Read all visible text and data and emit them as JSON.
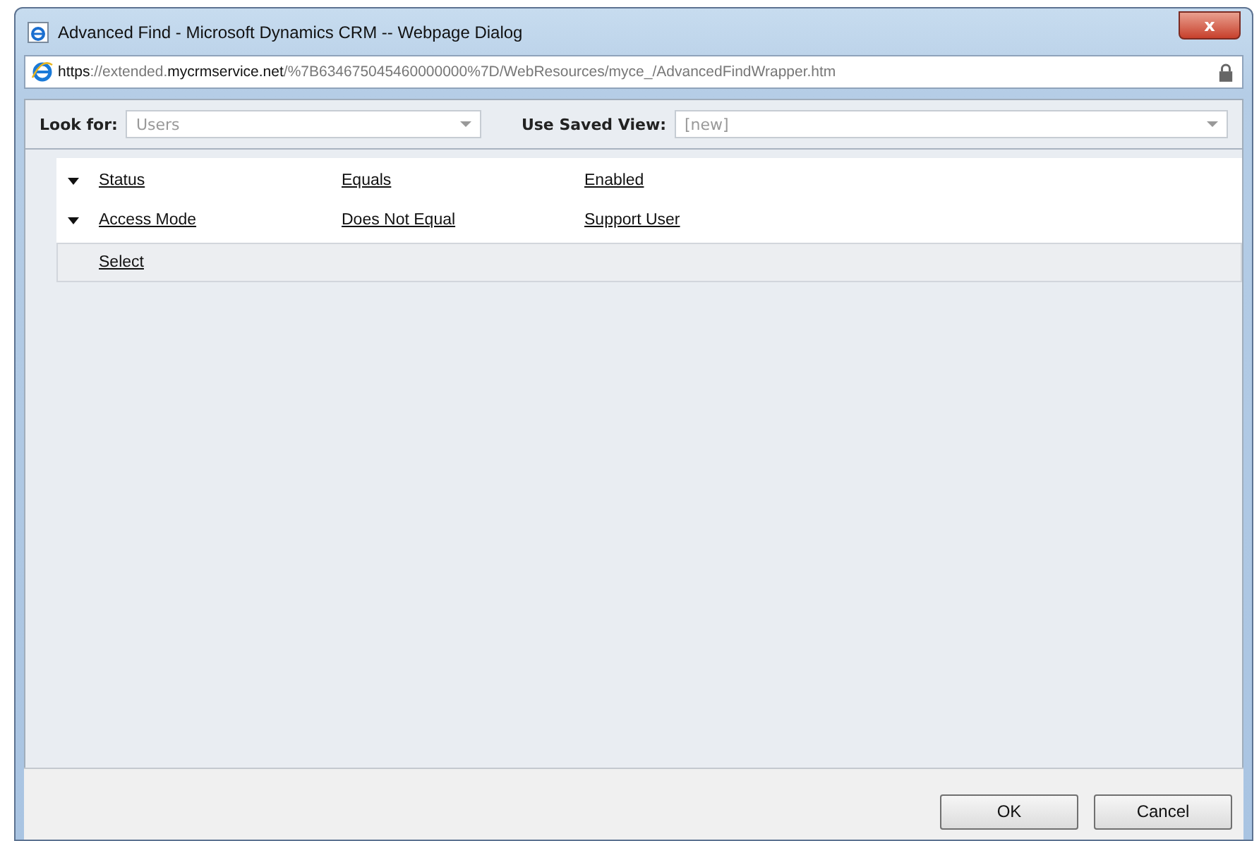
{
  "window": {
    "title": "Advanced Find - Microsoft Dynamics CRM -- Webpage Dialog",
    "close": "x"
  },
  "address": {
    "segments": [
      {
        "text": "https",
        "dark": true
      },
      {
        "text": "://extended.",
        "dark": false
      },
      {
        "text": "mycrmservice.net",
        "dark": true
      },
      {
        "text": "/%7B634675045460000000%7D/WebResources/myce_/AdvancedFindWrapper.htm",
        "dark": false
      }
    ]
  },
  "look_for": {
    "label": "Look for:",
    "value": "Users"
  },
  "saved_view": {
    "label": "Use Saved View:",
    "value": "[new]"
  },
  "conditions": [
    {
      "field": "Status",
      "operator": "Equals",
      "value": "Enabled"
    },
    {
      "field": "Access Mode",
      "operator": "Does Not Equal",
      "value": "Support User"
    }
  ],
  "select_link": "Select",
  "buttons": [
    "OK",
    "Cancel"
  ]
}
